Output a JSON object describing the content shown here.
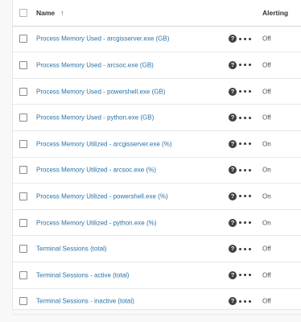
{
  "header": {
    "name_label": "Name",
    "sort_arrow": "↑",
    "alerting_label": "Alerting"
  },
  "rows": [
    {
      "name": "Process Memory Used - arcgisserver.exe (GB)",
      "alerting": "Off"
    },
    {
      "name": "Process Memory Used - arcsoc.exe (GB)",
      "alerting": "Off"
    },
    {
      "name": "Process Memory Used - powershell.exe (GB)",
      "alerting": "Off"
    },
    {
      "name": "Process Memory Used - python.exe (GB)",
      "alerting": "Off"
    },
    {
      "name": "Process Memory Utilized - arcgisserver.exe (%)",
      "alerting": "On"
    },
    {
      "name": "Process Memory Utilized - arcsoc.exe (%)",
      "alerting": "On"
    },
    {
      "name": "Process Memory Utilized - powershell.exe (%)",
      "alerting": "On"
    },
    {
      "name": "Process Memory Utilized - python.exe (%)",
      "alerting": "On"
    },
    {
      "name": "Terminal Sessions (total)",
      "alerting": "Off"
    },
    {
      "name": "Terminal Sessions - active (total)",
      "alerting": "Off"
    },
    {
      "name": "Terminal Sessions - inactive (total)",
      "alerting": "Off"
    }
  ],
  "icons": {
    "help": "question-circle-icon",
    "more": "ellipsis-icon",
    "help_glyph": "?"
  },
  "colors": {
    "link": "#2b73a8",
    "help_icon": "#3f3f3f"
  }
}
